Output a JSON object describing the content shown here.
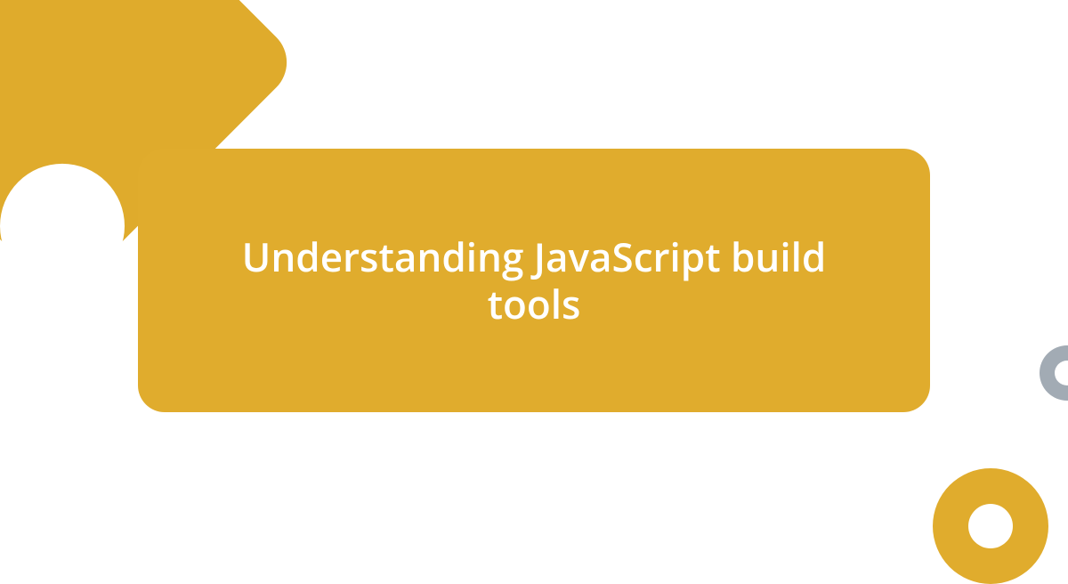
{
  "card": {
    "title": "Understanding JavaScript build tools"
  },
  "colors": {
    "gold": "#e0ac2d",
    "dark_gold": "#dfab2c",
    "gray": "#a2abb4",
    "white": "#ffffff"
  }
}
